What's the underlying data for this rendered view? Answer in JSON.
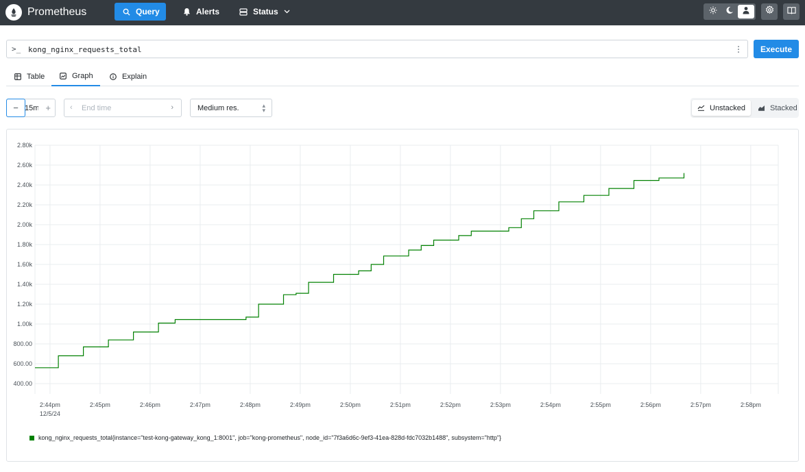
{
  "header": {
    "brand": "Prometheus",
    "nav": {
      "query": "Query",
      "alerts": "Alerts",
      "status": "Status"
    },
    "icons": [
      "prometheus-logo",
      "search-icon",
      "bell-icon",
      "server-icon",
      "chevron-down-icon",
      "sun-icon",
      "moon-icon",
      "user-icon",
      "gear-icon",
      "book-icon"
    ]
  },
  "query": {
    "prompt": ">_",
    "expression": "kong_nginx_requests_total",
    "execute_label": "Execute"
  },
  "tabs": {
    "table": "Table",
    "graph": "Graph",
    "explain": "Explain",
    "active": "Graph"
  },
  "controls": {
    "range_value": "15m",
    "end_time_placeholder": "End time",
    "resolution": "Medium res.",
    "unstacked_label": "Unstacked",
    "stacked_label": "Stacked",
    "stack_mode": "Unstacked"
  },
  "colors": {
    "accent": "#228be6",
    "topbar": "#343a40",
    "series": "#008000"
  },
  "chart_data": {
    "type": "line",
    "y_ticks": [
      "2.80k",
      "2.60k",
      "2.40k",
      "2.20k",
      "2.00k",
      "1.80k",
      "1.60k",
      "1.40k",
      "1.20k",
      "1.00k",
      "800.00",
      "600.00",
      "400.00"
    ],
    "x_ticks": [
      "2:44pm",
      "2:45pm",
      "2:46pm",
      "2:47pm",
      "2:48pm",
      "2:49pm",
      "2:50pm",
      "2:51pm",
      "2:52pm",
      "2:53pm",
      "2:54pm",
      "2:55pm",
      "2:56pm",
      "2:57pm",
      "2:58pm"
    ],
    "x_date_label": "12/5/24",
    "ylim": [
      400,
      2800
    ],
    "xlim": [
      "2:43:42pm",
      "2:58:33pm"
    ],
    "grid": true,
    "legend_position": "bottom",
    "series": [
      {
        "name": "kong_nginx_requests_total{instance=\"test-kong-gateway_kong_1:8001\", job=\"kong-prometheus\", node_id=\"7f3a6d6c-9ef3-41ea-828d-fdc7032b1488\", subsystem=\"http\"}",
        "points": [
          [
            "2:43:42pm",
            560
          ],
          [
            "2:44:10pm",
            560
          ],
          [
            "2:44:10pm",
            680
          ],
          [
            "2:44:40pm",
            680
          ],
          [
            "2:44:40pm",
            770
          ],
          [
            "2:45:10pm",
            770
          ],
          [
            "2:45:10pm",
            840
          ],
          [
            "2:45:40pm",
            840
          ],
          [
            "2:45:40pm",
            920
          ],
          [
            "2:46:10pm",
            920
          ],
          [
            "2:46:10pm",
            1010
          ],
          [
            "2:46:30pm",
            1010
          ],
          [
            "2:46:30pm",
            1045
          ],
          [
            "2:47:55pm",
            1045
          ],
          [
            "2:47:55pm",
            1070
          ],
          [
            "2:48:10pm",
            1070
          ],
          [
            "2:48:10pm",
            1200
          ],
          [
            "2:48:40pm",
            1200
          ],
          [
            "2:48:40pm",
            1295
          ],
          [
            "2:48:55pm",
            1295
          ],
          [
            "2:48:55pm",
            1310
          ],
          [
            "2:49:10pm",
            1310
          ],
          [
            "2:49:10pm",
            1420
          ],
          [
            "2:49:40pm",
            1420
          ],
          [
            "2:49:40pm",
            1500
          ],
          [
            "2:50:10pm",
            1500
          ],
          [
            "2:50:10pm",
            1535
          ],
          [
            "2:50:25pm",
            1535
          ],
          [
            "2:50:25pm",
            1600
          ],
          [
            "2:50:40pm",
            1600
          ],
          [
            "2:50:40pm",
            1685
          ],
          [
            "2:51:10pm",
            1685
          ],
          [
            "2:51:10pm",
            1745
          ],
          [
            "2:51:25pm",
            1745
          ],
          [
            "2:51:25pm",
            1790
          ],
          [
            "2:51:40pm",
            1790
          ],
          [
            "2:51:40pm",
            1845
          ],
          [
            "2:52:10pm",
            1845
          ],
          [
            "2:52:10pm",
            1890
          ],
          [
            "2:52:25pm",
            1890
          ],
          [
            "2:52:25pm",
            1935
          ],
          [
            "2:53:10pm",
            1935
          ],
          [
            "2:53:10pm",
            1970
          ],
          [
            "2:53:25pm",
            1970
          ],
          [
            "2:53:25pm",
            2060
          ],
          [
            "2:53:40pm",
            2060
          ],
          [
            "2:53:40pm",
            2140
          ],
          [
            "2:54:10pm",
            2140
          ],
          [
            "2:54:10pm",
            2230
          ],
          [
            "2:54:40pm",
            2230
          ],
          [
            "2:54:40pm",
            2295
          ],
          [
            "2:55:10pm",
            2295
          ],
          [
            "2:55:10pm",
            2365
          ],
          [
            "2:55:40pm",
            2365
          ],
          [
            "2:55:40pm",
            2445
          ],
          [
            "2:56:10pm",
            2445
          ],
          [
            "2:56:10pm",
            2470
          ],
          [
            "2:56:40pm",
            2470
          ],
          [
            "2:56:40pm",
            2520
          ]
        ]
      }
    ]
  }
}
